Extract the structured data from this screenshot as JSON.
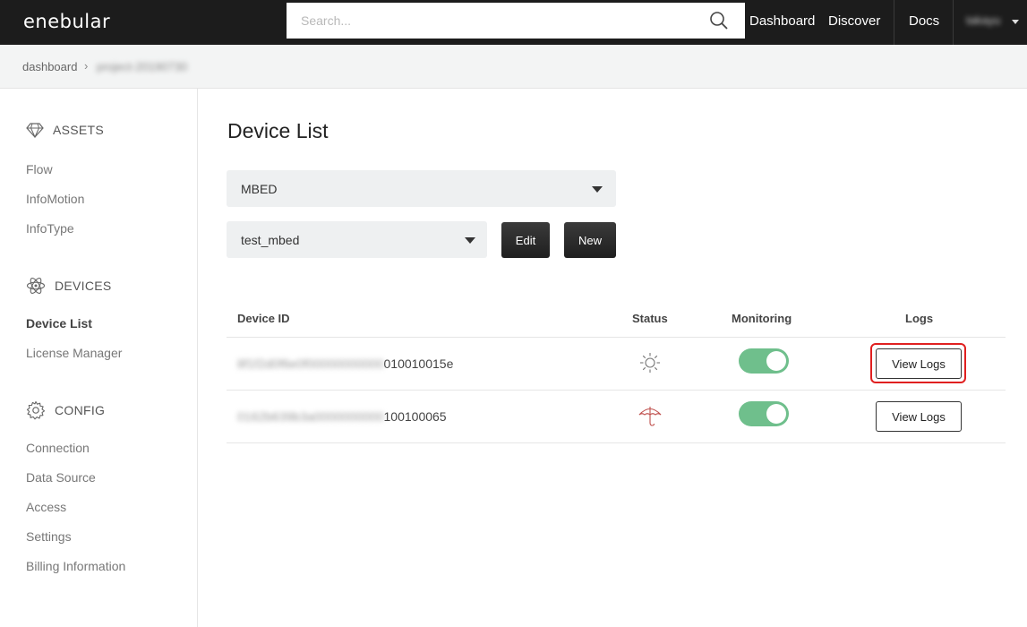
{
  "header": {
    "logo": "enebular",
    "search_placeholder": "Search...",
    "nav": [
      "Dashboard",
      "Discover",
      "Docs"
    ],
    "user": "takayu"
  },
  "breadcrumb": {
    "root": "dashboard",
    "separator": "›",
    "project": "project-20190730"
  },
  "sidebar": {
    "assets_title": "ASSETS",
    "assets_items": [
      "Flow",
      "InfoMotion",
      "InfoType"
    ],
    "devices_title": "DEVICES",
    "devices_items": [
      "Device List",
      "License Manager"
    ],
    "config_title": "CONFIG",
    "config_items": [
      "Connection",
      "Data Source",
      "Access",
      "Settings",
      "Billing Information"
    ]
  },
  "main": {
    "title": "Device List",
    "platform_select": "MBED",
    "connection_select": "test_mbed",
    "edit_label": "Edit",
    "new_label": "New",
    "columns": [
      "Device ID",
      "Status",
      "Monitoring",
      "Logs"
    ],
    "rows": [
      {
        "id_hidden": "8f1f2d0f6e0f00000000000",
        "id_visible": "010010015e",
        "status": "sun-icon",
        "monitoring": true,
        "logs_label": "View Logs"
      },
      {
        "id_hidden": "0162b639b3a0000000000",
        "id_visible": "100100065",
        "status": "umbrella-icon",
        "monitoring": true,
        "logs_label": "View Logs"
      }
    ]
  },
  "colors": {
    "topbar": "#1c1c1c",
    "toggle_on": "#6fbf8c",
    "highlight": "#e02020",
    "status_rain": "#c0504d"
  }
}
